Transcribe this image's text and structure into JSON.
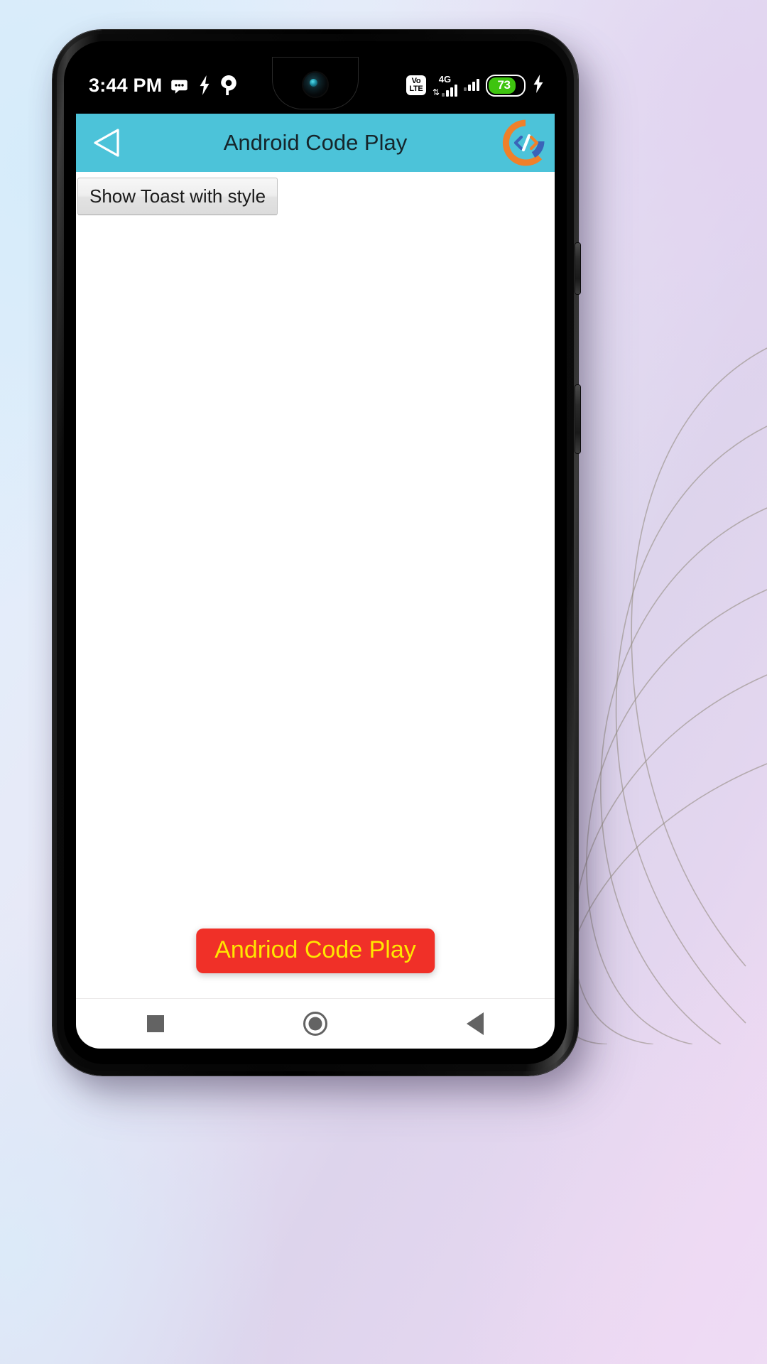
{
  "wallpaper": {
    "name": "gradient-arcs-wallpaper",
    "colors": [
      "#dfeefb",
      "#e3dff2",
      "#f0dff4"
    ]
  },
  "device": {
    "name": "android-phone",
    "notch": "waterdrop-notch",
    "side_buttons": [
      "volume-rocker",
      "power-button"
    ]
  },
  "status_bar": {
    "clock": "3:44 PM",
    "left_icons": [
      "messages-icon",
      "flash-icon",
      "pocket-icon"
    ],
    "volte": {
      "line1": "Vo",
      "line2": "LTE"
    },
    "network_label": "4G",
    "data_arrows": "⇅",
    "sim1_bars": 4,
    "sim1_active": 3,
    "sim2_bars": 4,
    "sim2_active": 3,
    "battery_percent": "73",
    "battery_level": 73,
    "battery_color": "#3ec40f",
    "charging_icon": "⚡",
    "background": "#000000",
    "foreground": "#ffffff"
  },
  "app_bar": {
    "title": "Android Code Play",
    "background": "#4cc3d9",
    "title_color": "#16252b",
    "back_icon": "back-triangle-icon",
    "logo": {
      "name": "android-code-play-logo",
      "arc_color": "#f0802a",
      "bracket_color": "#3a63b8",
      "glyph": "</>"
    }
  },
  "content": {
    "background": "#ffffff",
    "toast_button_label": "Show Toast with style"
  },
  "toast": {
    "message": "Andriod Code Play",
    "background": "#f03028",
    "text_color": "#ffe600"
  },
  "nav_bar": {
    "background": "#ffffff",
    "icon_color": "#636363",
    "buttons": [
      {
        "name": "recents",
        "icon": "square-icon"
      },
      {
        "name": "home",
        "icon": "circle-icon"
      },
      {
        "name": "back",
        "icon": "back-triangle-icon"
      }
    ]
  }
}
